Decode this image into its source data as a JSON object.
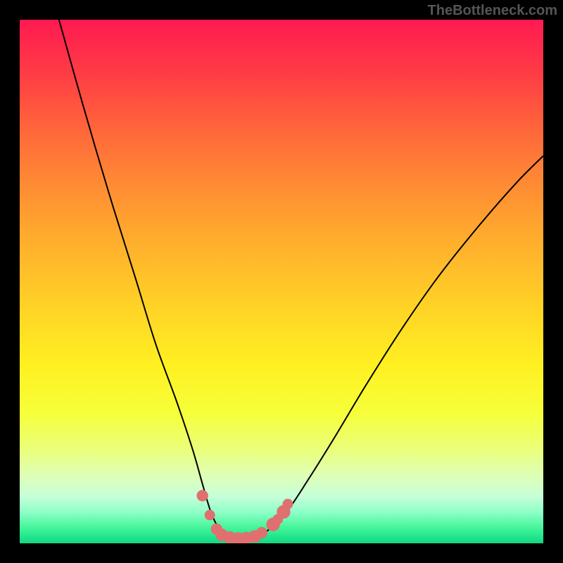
{
  "watermark": "TheBottleneck.com",
  "chart_data": {
    "type": "line",
    "title": "",
    "xlabel": "",
    "ylabel": "",
    "xlim": [
      0,
      100
    ],
    "ylim": [
      0,
      100
    ],
    "gradient_stops": [
      {
        "pct": 0,
        "color": "#ff1a51"
      },
      {
        "pct": 10,
        "color": "#ff3b45"
      },
      {
        "pct": 22,
        "color": "#ff6a3a"
      },
      {
        "pct": 32,
        "color": "#ff8d33"
      },
      {
        "pct": 43,
        "color": "#ffb02c"
      },
      {
        "pct": 55,
        "color": "#ffd326"
      },
      {
        "pct": 66,
        "color": "#fff021"
      },
      {
        "pct": 75,
        "color": "#f6ff39"
      },
      {
        "pct": 82,
        "color": "#eaff7a"
      },
      {
        "pct": 87,
        "color": "#deffb5"
      },
      {
        "pct": 91,
        "color": "#c7ffd8"
      },
      {
        "pct": 94,
        "color": "#8fffc8"
      },
      {
        "pct": 97,
        "color": "#45f59a"
      },
      {
        "pct": 99,
        "color": "#1de38a"
      },
      {
        "pct": 100,
        "color": "#14d683"
      }
    ],
    "series": [
      {
        "name": "bottleneck-curve",
        "x": [
          7.5,
          12,
          17,
          22,
          26,
          30,
          33,
          35,
          36.5,
          38,
          40,
          42,
          44,
          46,
          48,
          51,
          55,
          60,
          66,
          73,
          80,
          88,
          95,
          100
        ],
        "y": [
          100,
          84,
          67,
          51,
          38,
          27,
          18,
          11,
          6,
          3,
          1.5,
          1,
          1,
          1.5,
          3,
          6,
          12,
          20,
          30,
          41,
          51,
          61,
          69,
          74
        ]
      }
    ],
    "markers": [
      {
        "x": 34.9,
        "y": 9.1,
        "r": 1.1
      },
      {
        "x": 36.3,
        "y": 5.4,
        "r": 1.0
      },
      {
        "x": 37.6,
        "y": 2.7,
        "r": 1.1
      },
      {
        "x": 38.6,
        "y": 1.6,
        "r": 1.2
      },
      {
        "x": 40.1,
        "y": 1.1,
        "r": 1.2
      },
      {
        "x": 41.7,
        "y": 0.9,
        "r": 1.2
      },
      {
        "x": 43.3,
        "y": 1.0,
        "r": 1.2
      },
      {
        "x": 44.9,
        "y": 1.3,
        "r": 1.2
      },
      {
        "x": 46.2,
        "y": 2.0,
        "r": 1.1
      },
      {
        "x": 48.4,
        "y": 3.6,
        "r": 1.3
      },
      {
        "x": 49.3,
        "y": 4.6,
        "r": 1.0
      },
      {
        "x": 50.4,
        "y": 6.0,
        "r": 1.3
      },
      {
        "x": 51.2,
        "y": 7.5,
        "r": 1.0
      }
    ],
    "marker_color": "#e07070"
  }
}
